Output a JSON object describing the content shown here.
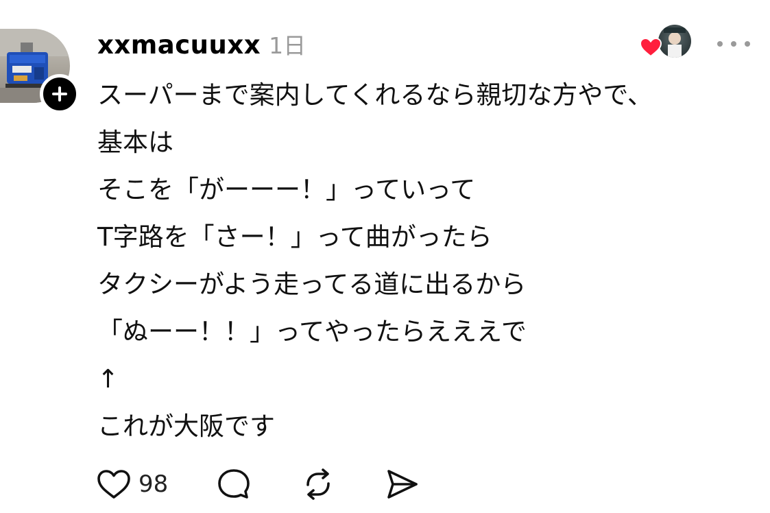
{
  "post": {
    "username": "xxmacuuxx",
    "timestamp": "1日",
    "lines": [
      "スーパーまで案内してくれるなら親切な方やで、",
      "基本は",
      "そこを「がーーー！」っていって",
      "T字路を「さー！」って曲がったら",
      "タクシーがよう走ってる道に出るから",
      "「ぬーー！！」ってやったらえええで",
      "↑",
      "これが大阪です"
    ],
    "like_count": "98"
  },
  "icons": {
    "follow": "plus-icon",
    "like": "heart-icon",
    "comment": "speech-bubble-icon",
    "repost": "repost-icon",
    "share": "send-icon",
    "more": "ellipsis-icon"
  },
  "colors": {
    "liked_heart": "#ff1f3d",
    "timestamp": "#9a9a9a",
    "text": "#111111"
  }
}
